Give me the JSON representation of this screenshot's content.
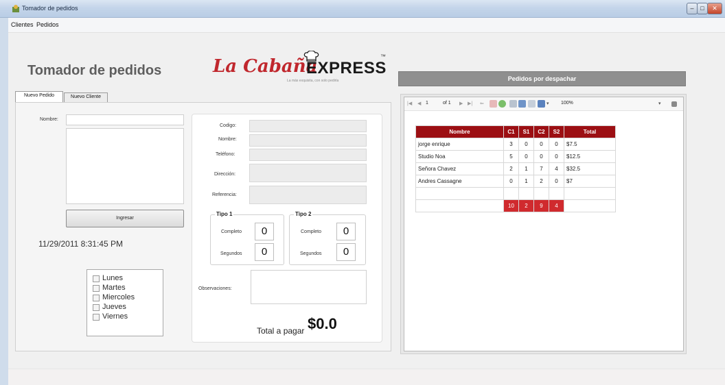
{
  "window": {
    "title": "Tomador de pedidos"
  },
  "menu": [
    "Clientes",
    "Pedidos"
  ],
  "header": {
    "title": "Tomador de pedidos",
    "logo_script": "La Cabaña",
    "logo_express": "EXPRESS",
    "logo_tm": "™",
    "logo_slogan": "La más exquisita, con solo pedirla"
  },
  "tabs": [
    "Nuevo Pedido",
    "Nuevo Cliente"
  ],
  "order": {
    "name_label": "Nombre:",
    "ingresar_label": "Ingresar",
    "datetime": "11/29/2011 8:31:45 PM",
    "days": [
      "Lunes",
      "Martes",
      "Miercoles",
      "Jueves",
      "Viernes"
    ]
  },
  "client": {
    "codigo": "Codigo:",
    "nombre": "Nombre:",
    "telefono": "Teléfono:",
    "direccion": "Dirección:",
    "referencia": "Referencia:",
    "observaciones": "Observaciones:"
  },
  "tipo1": {
    "title": "Tipo 1",
    "completo_label": "Completo",
    "completo": "0",
    "segundos_label": "Segundos",
    "segundos": "0"
  },
  "tipo2": {
    "title": "Tipo 2",
    "completo_label": "Completo",
    "completo": "0",
    "segundos_label": "Segundos",
    "segundos": "0"
  },
  "total": {
    "label": "Total a pagar",
    "value": "$0.0"
  },
  "pending": {
    "header": "Pedidos por despachar",
    "toolbar": {
      "page": "1",
      "of": "of 1",
      "zoom": "100%"
    },
    "columns": [
      "Nombre",
      "C1",
      "S1",
      "C2",
      "S2",
      "Total"
    ],
    "rows": [
      [
        "jorge enrique",
        "3",
        "0",
        "0",
        "0",
        "$7.5"
      ],
      [
        "Studio Noa",
        "5",
        "0",
        "0",
        "0",
        "$12.5"
      ],
      [
        "Señora Chavez",
        "2",
        "1",
        "7",
        "4",
        "$32.5"
      ],
      [
        "Andres Cassagne",
        "0",
        "1",
        "2",
        "0",
        "$7"
      ]
    ],
    "totals": [
      "10",
      "2",
      "9",
      "4"
    ]
  },
  "colors": {
    "accent_red": "#9c0f13",
    "total_red": "#d02a2e",
    "header_grey": "#8f8f8f"
  }
}
